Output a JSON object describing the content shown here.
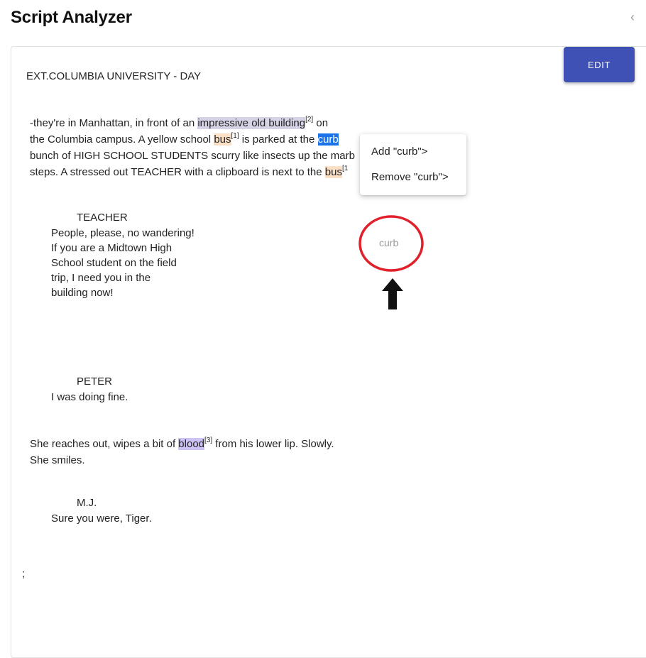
{
  "header": {
    "title": "Script Analyzer",
    "collapse_glyph": "‹"
  },
  "toolbar": {
    "edit_label": "EDIT"
  },
  "script": {
    "scene_heading": "EXT.COLUMBIA UNIVERSITY - DAY",
    "action1": {
      "l1_a": "-they're in Manhattan, in front of an ",
      "l1_hl": "impressive old building",
      "l1_sup": "[2]",
      "l1_b": " on",
      "l2_a": "the Columbia campus. A yellow school ",
      "l2_hl": "bus",
      "l2_sup": "[1]",
      "l2_b": " is parked at the ",
      "l2_sel": "curb",
      "l3": "bunch of HIGH SCHOOL STUDENTS scurry like insects up the marb",
      "l4_a": "steps. A stressed out TEACHER with a clipboard is next to the ",
      "l4_hl": "bus",
      "l4_sup": "[1"
    },
    "teacher": {
      "name": "TEACHER",
      "lines": [
        "People, please, no wandering!",
        "If  you are a Midtown High",
        "School  student on the field",
        "trip, I need  you in the",
        "building now!"
      ]
    },
    "peter": {
      "name": "PETER",
      "line": "I was doing fine."
    },
    "action2": {
      "l1_a": "She reaches out, wipes a bit of ",
      "l1_hl": "blood",
      "l1_sup": "[3]",
      "l1_b": " from his lower lip. Slowly.",
      "l2": "She smiles."
    },
    "mj": {
      "name": "M.J.",
      "line": "Sure you were, Tiger."
    },
    "trailing": ";"
  },
  "context_menu": {
    "add_label": "Add \"curb\">",
    "remove_label": "Remove \"curb\">"
  },
  "annotation": {
    "placeholder_word": "curb",
    "circle_color": "#e0202a",
    "arrow_color": "#111111",
    "circle_icon": "red-circle-icon",
    "arrow_icon": "up-arrow-icon"
  },
  "colors": {
    "accent": "#3f51b5",
    "selection": "#1a73e8",
    "highlight_building": "#d7d3e6",
    "highlight_bus": "#fbe0c5",
    "highlight_blood": "#cfc3f5"
  }
}
